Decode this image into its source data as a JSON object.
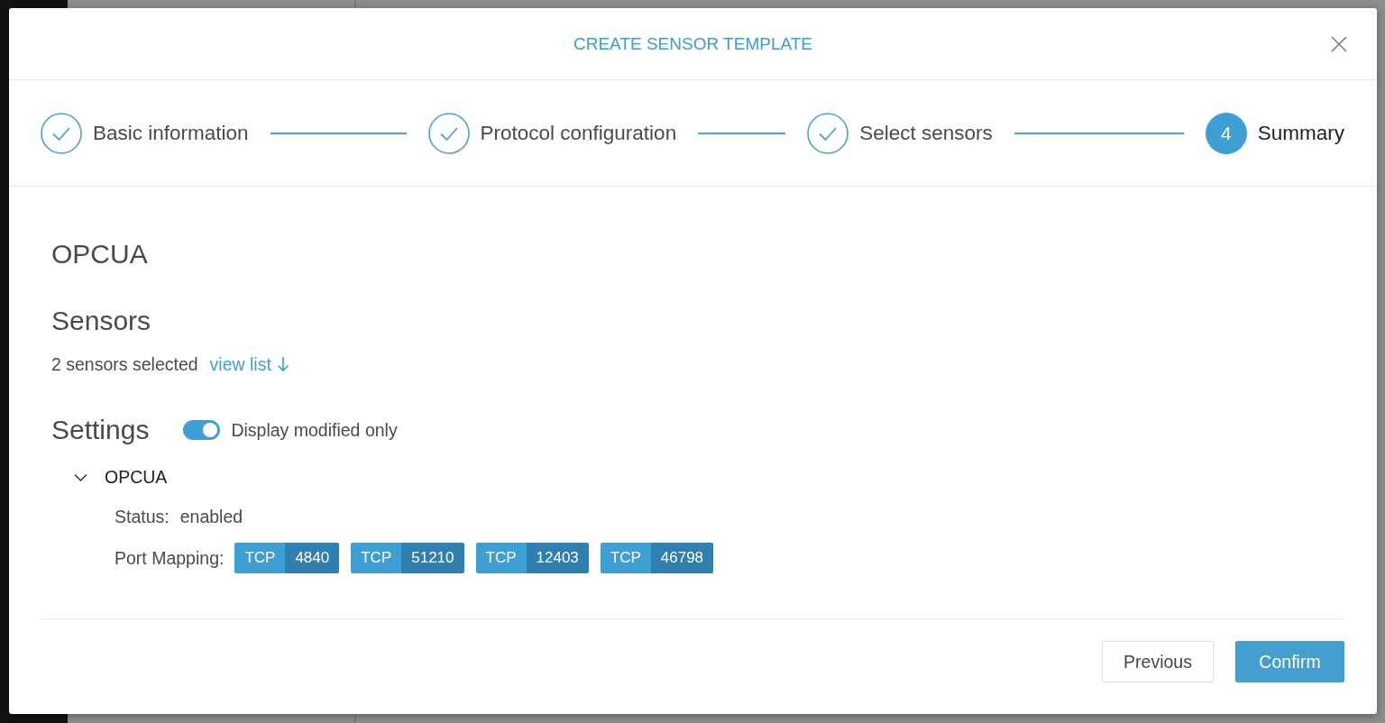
{
  "dialog": {
    "title": "CREATE SENSOR TEMPLATE"
  },
  "steps": [
    {
      "label": "Basic information",
      "completed": true,
      "selected": false
    },
    {
      "label": "Protocol configuration",
      "completed": true,
      "selected": false
    },
    {
      "label": "Select sensors",
      "completed": true,
      "selected": false
    },
    {
      "label": "Summary",
      "number": "4",
      "completed": false,
      "selected": true
    }
  ],
  "protocol": {
    "name": "OPCUA"
  },
  "sensors": {
    "heading": "Sensors",
    "summary": "2 sensors selected",
    "link": "view list"
  },
  "settings": {
    "heading": "Settings",
    "toggle": {
      "label": "Display modified only",
      "on": true
    },
    "tree": [
      {
        "label": "OPCUA",
        "expanded": true,
        "fields": [
          {
            "kind": "text",
            "label": "Status:",
            "value": "enabled"
          },
          {
            "kind": "ports",
            "label": "Port Mapping:",
            "ports": [
              {
                "protocol": "TCP",
                "port": "4840"
              },
              {
                "protocol": "TCP",
                "port": "51210"
              },
              {
                "protocol": "TCP",
                "port": "12403"
              },
              {
                "protocol": "TCP",
                "port": "46798"
              }
            ]
          }
        ]
      }
    ]
  },
  "buttons": [
    {
      "label": "Previous",
      "kind": "secondary"
    },
    {
      "label": "Confirm",
      "kind": "primary"
    }
  ]
}
